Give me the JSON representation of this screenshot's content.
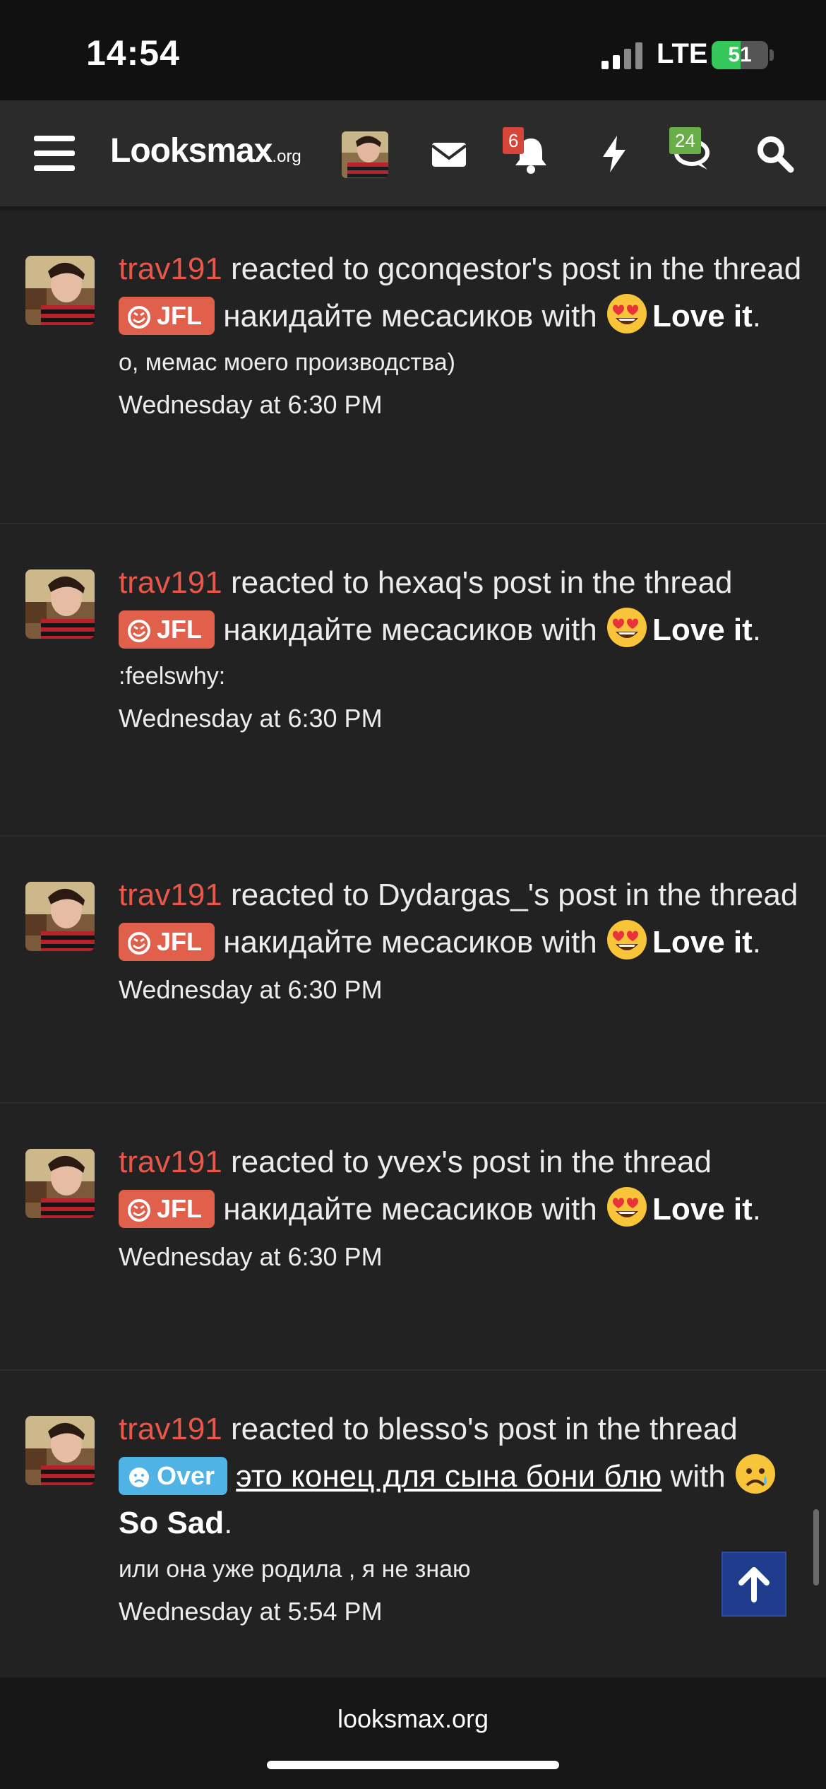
{
  "status_bar": {
    "time": "14:54",
    "network": "LTE",
    "battery": "51"
  },
  "nav": {
    "logo_main": "Looksmax",
    "logo_suffix": ".org",
    "alerts_count": "6",
    "conversations_count": "24"
  },
  "feed": [
    {
      "user": "trav191",
      "action_text": " reacted to gconqestor's post in the thread ",
      "prefix_label": "JFL",
      "prefix_color": "#e0604b",
      "thread_title": "накидайте месасиков",
      "with_text": " with ",
      "reaction": "Love it",
      "snippet": "о, мемас моего производства)",
      "time": "Wednesday at 6:30 PM"
    },
    {
      "user": "trav191",
      "action_text": " reacted to hexaq's post in the thread ",
      "prefix_label": "JFL",
      "prefix_color": "#e0604b",
      "thread_title": "накидайте месасиков",
      "with_text": " with ",
      "reaction": "Love it",
      "snippet": ":feelswhy:",
      "time": "Wednesday at 6:30 PM"
    },
    {
      "user": "trav191",
      "action_text": " reacted to Dydargas_'s post in the thread ",
      "prefix_label": "JFL",
      "prefix_color": "#e0604b",
      "thread_title": "накидайте месасиков",
      "with_text": " with ",
      "reaction": "Love it",
      "snippet": "",
      "time": "Wednesday at 6:30 PM"
    },
    {
      "user": "trav191",
      "action_text": " reacted to yvex's post in the thread ",
      "prefix_label": "JFL",
      "prefix_color": "#e0604b",
      "thread_title": "накидайте месасиков",
      "with_text": " with ",
      "reaction": "Love it",
      "snippet": "",
      "time": "Wednesday at 6:30 PM"
    },
    {
      "user": "trav191",
      "action_text": " reacted to blesso's post in the thread ",
      "prefix_label": "Over",
      "prefix_color": "#4fb3e6",
      "thread_title": "это конец для сына бони блю",
      "with_text": " with ",
      "reaction": "So Sad",
      "snippet": "или она уже родила , я не знаю",
      "time": "Wednesday at 5:54 PM"
    }
  ],
  "footer": {
    "domain": "looksmax.org"
  }
}
